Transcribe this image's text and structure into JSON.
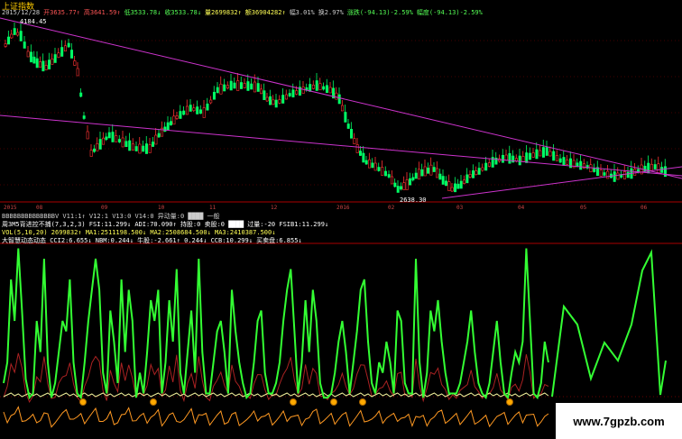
{
  "window": {
    "title": "上证指数"
  },
  "info_bar": [
    {
      "label": "2015/12/28",
      "color": "#cccccc"
    },
    {
      "label": "开3635.77↑",
      "color": "#ff5555"
    },
    {
      "label": "高3641.59↑",
      "color": "#ff5555"
    },
    {
      "label": "低3533.78↓",
      "color": "#55ff55"
    },
    {
      "label": "收3533.78↓",
      "color": "#55ff55"
    },
    {
      "label": "量2699832↑",
      "color": "#ffff55"
    },
    {
      "label": "额36904282↑",
      "color": "#ffff55"
    },
    {
      "label": "幅3.01%",
      "color": "#cccccc"
    },
    {
      "label": "换2.97%",
      "color": "#cccccc"
    },
    {
      "label": "涨跌(-94.13)-2.59%",
      "color": "#55ff55"
    },
    {
      "label": "幅度(-94.13)-2.59%",
      "color": "#55ff55"
    }
  ],
  "price_labels": {
    "high": "4184.45",
    "low": "2638.30"
  },
  "x_axis_labels": [
    "2015",
    "08",
    "09",
    "10",
    "11",
    "12",
    "2016",
    "02",
    "03",
    "04",
    "05",
    "06"
  ],
  "indicator_rows": [
    {
      "text": "BBBBBBBBBBBBBBV V11:1↑ V12:1  V13:0  V14:0  异动量:0 ████ 一般",
      "color": "#cccccc"
    },
    {
      "text": "周3M5背进控不捕(7,3,2,3) FSI:11.299↓ ADI:70.090↑ 持股:0 卖股:0 ████ 过量:-20 FSIB1:11.299↓",
      "color": "#ffffff"
    },
    {
      "text": "VOL(5,10,20) 2699832↑ MA1:2511198.500↓ MA2:2508684.500↓ MA3:2410387.500↓",
      "color": "#ffff55"
    },
    {
      "text": "大智慧动态动态 CCI2:6.655↓ NBM:0.244↓ 牛股:-2.661↑ 0.244↓ CCB:10.299↓ 买卖盘:6.855↓",
      "color": "#ffffff"
    }
  ],
  "watermark": "www.7gpzb.com",
  "colors": {
    "up": "#ff3333",
    "down": "#00ff66",
    "trend": "#cc33cc",
    "osc_green": "#33ff33",
    "osc_red": "#aa2222",
    "osc_orange": "#ff9922",
    "osc_yellow": "#eeee99"
  },
  "osc_green_series": [
    10,
    20,
    60,
    40,
    75,
    45,
    12,
    3,
    5,
    40,
    25,
    70,
    20,
    3,
    10,
    25,
    40,
    35,
    60,
    20,
    5,
    3,
    20,
    40,
    55,
    70,
    55,
    15,
    5,
    45,
    30,
    10,
    60,
    25,
    55,
    40,
    3,
    15,
    5,
    25,
    50,
    40,
    55,
    5,
    20,
    50,
    30,
    65,
    15,
    5,
    25,
    45,
    15,
    70,
    25,
    5,
    5,
    20,
    35,
    40,
    25,
    5,
    55,
    35,
    20,
    10,
    3,
    5,
    20,
    40,
    45,
    15,
    5,
    5,
    10,
    20,
    40,
    55,
    65,
    35,
    5,
    20,
    50,
    25,
    55,
    40,
    10,
    3,
    3,
    5,
    15,
    30,
    40,
    25,
    5,
    20,
    35,
    55,
    60,
    30,
    10,
    5,
    20,
    15,
    30,
    20,
    5,
    45,
    40,
    10,
    5,
    5,
    70,
    20,
    3,
    15,
    45,
    35,
    50,
    30,
    15,
    5,
    5,
    5,
    10,
    20,
    30,
    45,
    25,
    10,
    5,
    3,
    10,
    25,
    40,
    20,
    5,
    3,
    15,
    25,
    20,
    30,
    75,
    40,
    5,
    3,
    10,
    30,
    20
  ]
}
